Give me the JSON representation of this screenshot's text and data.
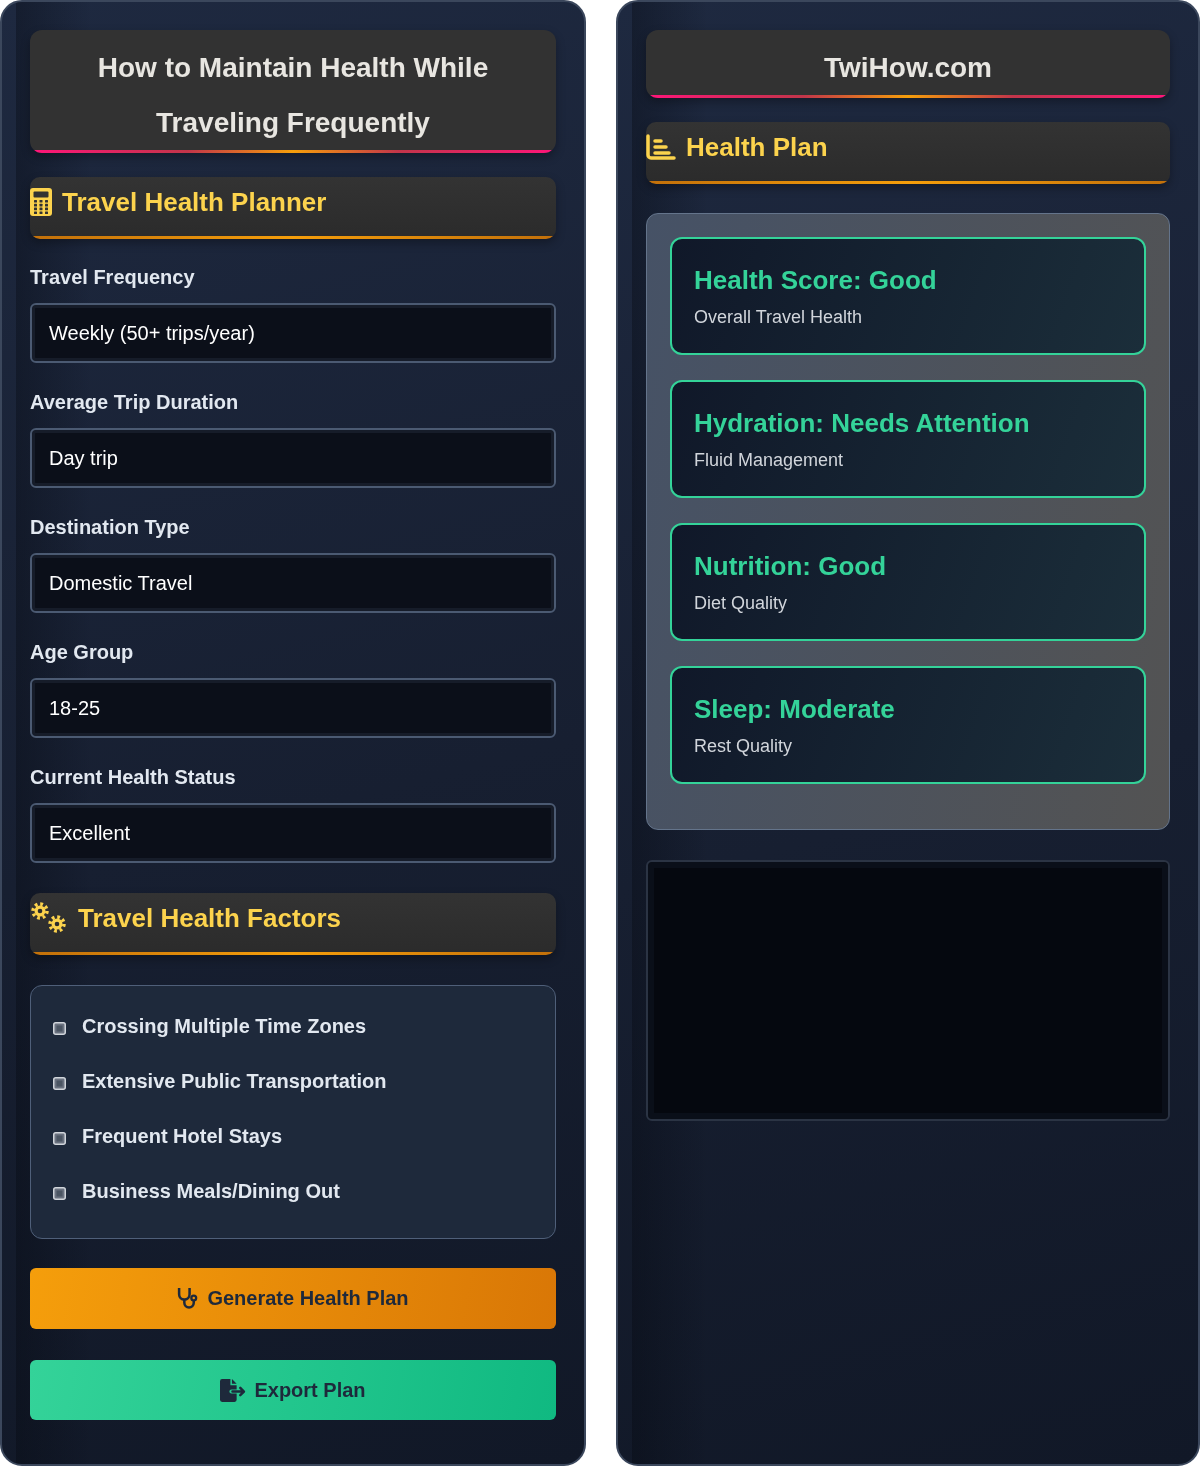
{
  "article": {
    "title": "How to Maintain Health While Traveling Frequently"
  },
  "planner": {
    "heading": "Travel Health Planner",
    "fields": [
      {
        "label": "Travel Frequency",
        "value": "Weekly (50+ trips/year)"
      },
      {
        "label": "Average Trip Duration",
        "value": "Day trip"
      },
      {
        "label": "Destination Type",
        "value": "Domestic Travel"
      },
      {
        "label": "Age Group",
        "value": "18-25"
      },
      {
        "label": "Current Health Status",
        "value": "Excellent"
      }
    ]
  },
  "factors": {
    "heading": "Travel Health Factors",
    "items": [
      {
        "label": "Crossing Multiple Time Zones",
        "checked": false
      },
      {
        "label": "Extensive Public Transportation",
        "checked": false
      },
      {
        "label": "Frequent Hotel Stays",
        "checked": false
      },
      {
        "label": "Business Meals/Dining Out",
        "checked": false
      }
    ]
  },
  "buttons": [
    {
      "label": "Generate Health Plan",
      "kind": "generate"
    },
    {
      "label": "Export Plan",
      "kind": "export"
    }
  ],
  "site": {
    "name": "TwiHow.com"
  },
  "health_plan": {
    "heading": "Health Plan",
    "cards": [
      {
        "title": "Health Score: Good",
        "subtitle": "Overall Travel Health"
      },
      {
        "title": "Hydration: Needs Attention",
        "subtitle": "Fluid Management"
      },
      {
        "title": "Nutrition: Good",
        "subtitle": "Diet Quality"
      },
      {
        "title": "Sleep: Moderate",
        "subtitle": "Rest Quality"
      }
    ]
  }
}
